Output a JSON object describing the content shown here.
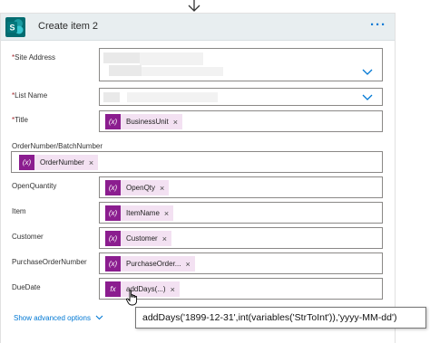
{
  "card": {
    "title": "Create item 2",
    "more_label": "···",
    "accent": "#0078d4",
    "header_bg": "#e8eef0",
    "token_color": "#8b1d8f"
  },
  "fields": {
    "site_address": {
      "label": "Site Address",
      "required": "*"
    },
    "list_name": {
      "label": "List Name",
      "required": "*"
    },
    "title": {
      "label": "Title",
      "required": "*",
      "token_icon": "(x)",
      "token": "BusinessUnit",
      "remove": "×"
    },
    "order_number": {
      "label": "OrderNumber/BatchNumber",
      "token_icon": "(x)",
      "token": "OrderNumber",
      "remove": "×"
    },
    "open_quantity": {
      "label": "OpenQuantity",
      "token_icon": "(x)",
      "token": "OpenQty",
      "remove": "×"
    },
    "item": {
      "label": "Item",
      "token_icon": "(x)",
      "token": "ItemName",
      "remove": "×"
    },
    "customer": {
      "label": "Customer",
      "token_icon": "(x)",
      "token": "Customer",
      "remove": "×"
    },
    "purchase_order_number": {
      "label": "PurchaseOrderNumber",
      "token_icon": "(x)",
      "token": "PurchaseOrder...",
      "remove": "×"
    },
    "due_date": {
      "label": "DueDate",
      "token_icon": "fx",
      "token": "addDays(...)",
      "remove": "×"
    }
  },
  "advanced": {
    "label": "Show advanced options",
    "chevron": "﹀"
  },
  "tooltip": {
    "text": "addDays('1899-12-31',int(variables('StrToInt')),'yyyy-MM-dd')"
  },
  "icons": [
    "down-arrow-icon",
    "sharepoint-logo-icon",
    "chevron-down-icon",
    "variable-icon",
    "expression-icon",
    "close-icon",
    "hand-cursor-icon"
  ]
}
